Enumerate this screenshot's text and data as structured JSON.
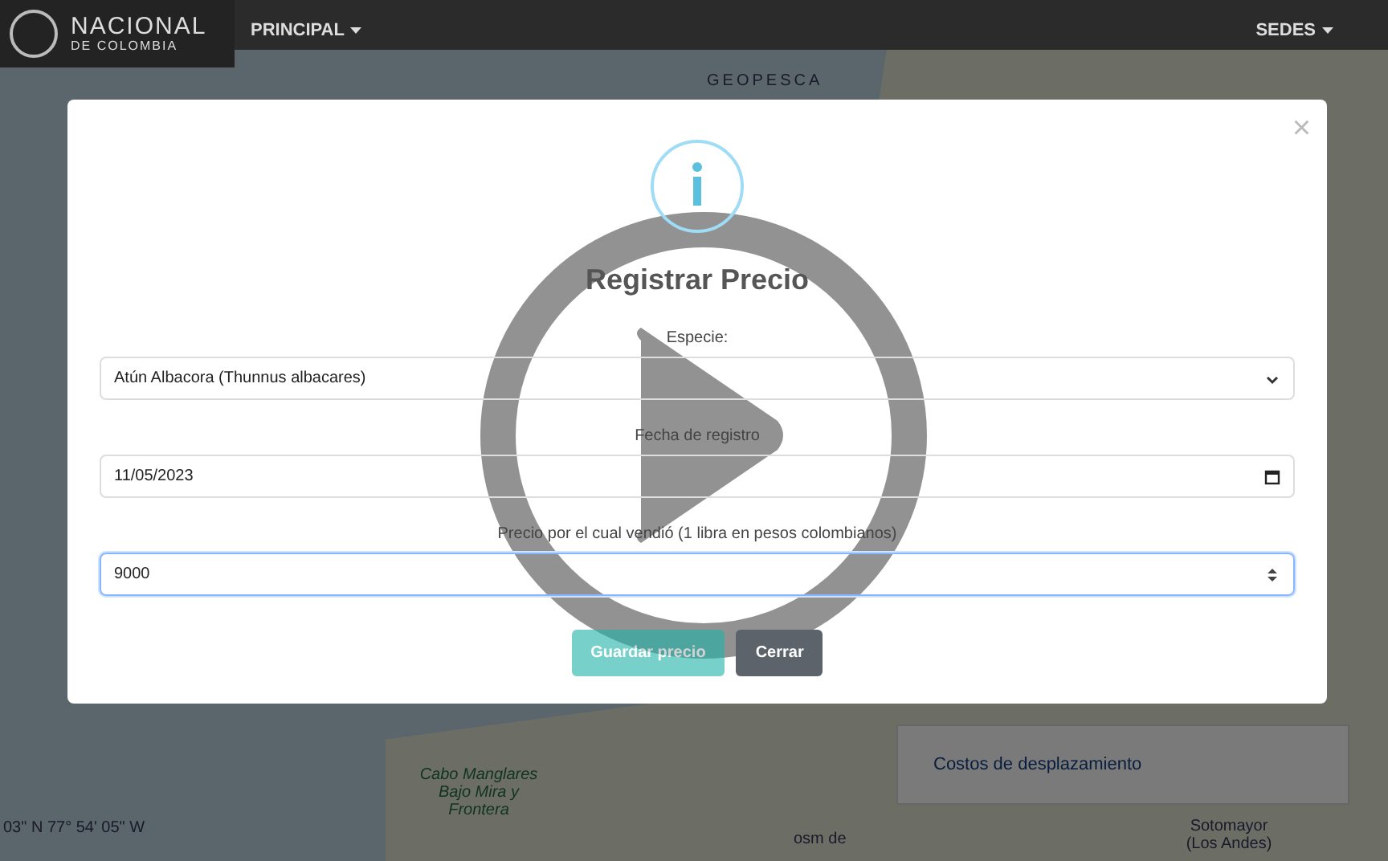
{
  "header": {
    "logo_title": "NACIONAL",
    "logo_subtitle": "DE COLOMBIA",
    "menu": [
      {
        "label": "PRINCIPAL"
      },
      {
        "label": "SEDES"
      }
    ]
  },
  "map": {
    "brand": "GEOPESCA",
    "area_label": "Cabo Manglares Bajo Mira y Frontera",
    "coordinates": "03\" N 77° 54' 05\" W",
    "inset_label": "osm de",
    "place_label": "Sotomayor (Los Andes)",
    "panel_link": "Costos de desplazamiento"
  },
  "dialog": {
    "close_symbol": "×",
    "title": "Registrar Precio",
    "fields": [
      {
        "kind": "select",
        "label": "Especie:",
        "value": "Atún Albacora (Thunnus albacares)",
        "focused": false
      },
      {
        "kind": "date",
        "label": "Fecha de registro",
        "value": "11/05/2023",
        "focused": false
      },
      {
        "kind": "number",
        "label": "Precio por el cual vendió (1 libra en pesos colombianos)",
        "value": "9000",
        "focused": true
      }
    ],
    "buttons": [
      {
        "kind": "primary",
        "label": "Guardar precio",
        "disabled": true
      },
      {
        "kind": "secondary",
        "label": "Cerrar",
        "disabled": false
      }
    ]
  }
}
